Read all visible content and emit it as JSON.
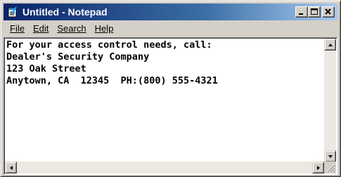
{
  "window": {
    "title": "Untitled - Notepad",
    "title_icon": "notepad-icon"
  },
  "title_buttons": [
    "minimize-icon",
    "maximize-icon",
    "close-icon"
  ],
  "menu": [
    {
      "label": "File"
    },
    {
      "label": "Edit"
    },
    {
      "label": "Search"
    },
    {
      "label": "Help"
    }
  ],
  "document": {
    "lines": [
      "For your access control needs, call:",
      "Dealer's Security Company",
      "123 Oak Street",
      "Anytown, CA  12345  PH:(800) 555-4321"
    ]
  },
  "colors": {
    "title_active": "#0a246a",
    "title_gradient_end": "#a6caf0",
    "face": "#d4d0c8"
  }
}
